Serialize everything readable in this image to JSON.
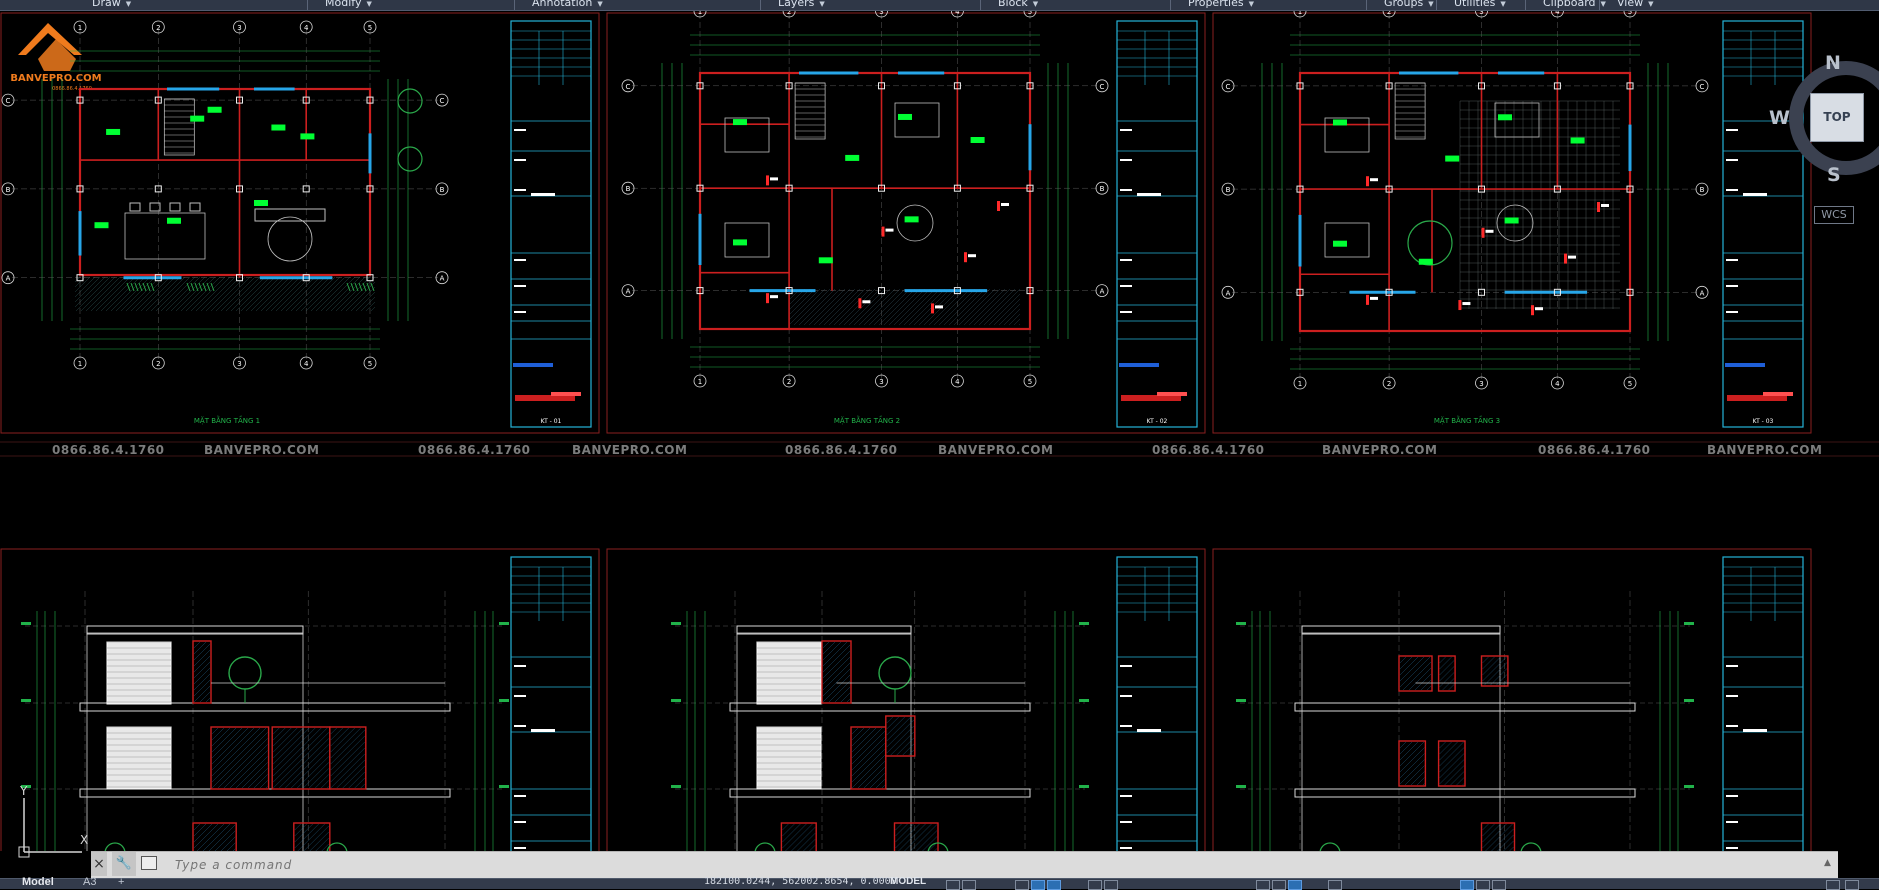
{
  "ribbon": {
    "panels": [
      "Draw",
      "Modify",
      "Annotation",
      "Layers",
      "Block",
      "Properties",
      "Groups",
      "Utilities",
      "Clipboard",
      "View"
    ]
  },
  "drawing": {
    "logo": {
      "brand": "BANVEPRO.COM",
      "phone": "0866.86.4.1760"
    },
    "watermarks": [
      "0866.86.4.1760",
      "BANVEPRO.COM"
    ],
    "sheet_titles": [
      "MẶT BẰNG TẦNG 1",
      "MẶT BẰNG TẦNG 2",
      "MẶT BẰNG TẦNG 3"
    ],
    "sheet_codes": [
      "KT - 01",
      "KT - 02",
      "KT - 03"
    ],
    "grid_letters": [
      "A",
      "B",
      "C"
    ],
    "grid_numbers": [
      "1",
      "2",
      "3",
      "4",
      "5"
    ]
  },
  "viewcube": {
    "north": "N",
    "south": "S",
    "west": "W",
    "face": "TOP",
    "wcs": "WCS"
  },
  "ucs": {
    "x": "X",
    "y": "Y"
  },
  "command": {
    "close": "×",
    "placeholder": "Type a command"
  },
  "status": {
    "model_tab": "Model",
    "layout_tab": "A3",
    "add_tab": "+",
    "coords": "182100.0244, 562002.8654, 0.0000",
    "space": "MODEL"
  },
  "colors": {
    "background": "#000000",
    "wall": "#cc1f1f",
    "window": "#27a6e8",
    "dimension": "#21b24a",
    "room_tag": "#00ff33",
    "titleblock": "#24b3d8",
    "grid_line": "#5a5a5a"
  }
}
